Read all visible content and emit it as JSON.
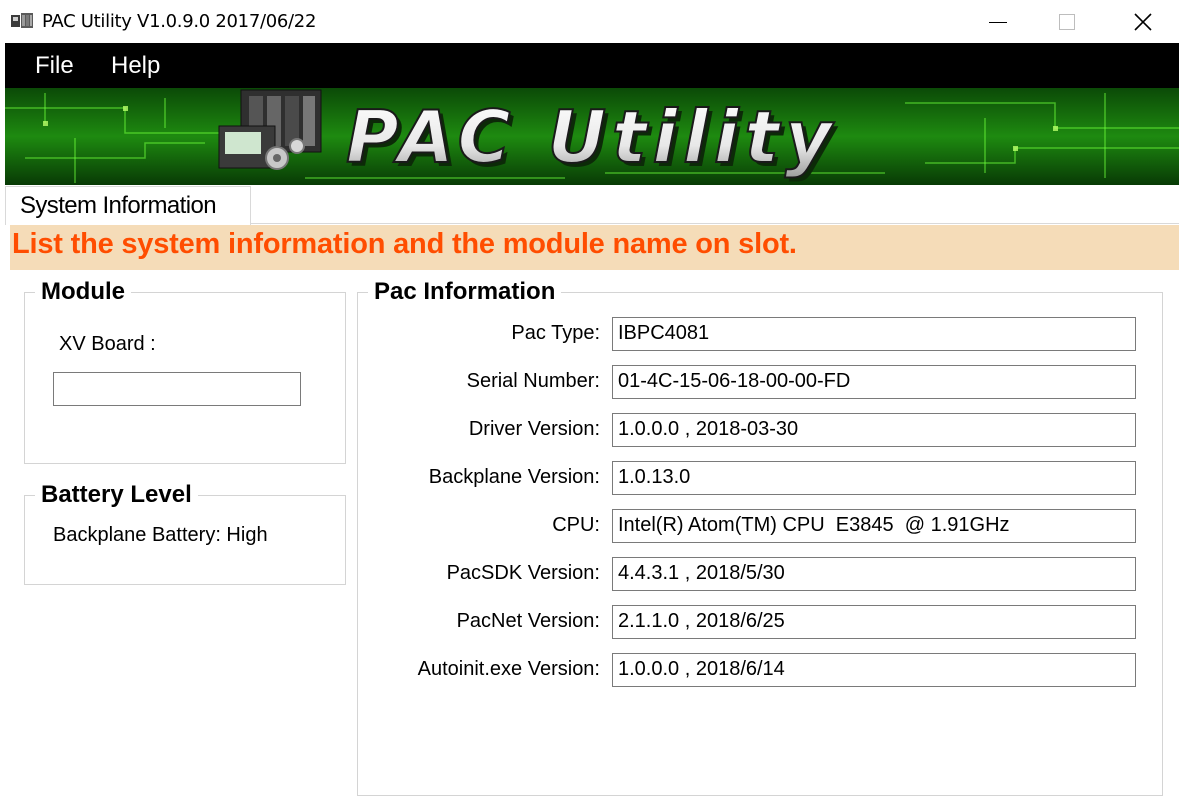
{
  "window": {
    "title": "PAC Utility V1.0.9.0  2017/06/22",
    "controls": {
      "minimize_icon": "minimize-icon",
      "maximize_icon": "maximize-icon",
      "close_icon": "close-icon"
    }
  },
  "menu": {
    "items": [
      "File",
      "Help"
    ]
  },
  "banner": {
    "text": "PAC Utility"
  },
  "tabs": [
    {
      "label": "System Information",
      "active": true
    }
  ],
  "heading": {
    "text": "List the system information and the module name on slot.",
    "color": "#ff4d00",
    "background": "#f5dcb8"
  },
  "module": {
    "title": "Module",
    "xv_board_label": "XV Board :",
    "xv_board_value": ""
  },
  "battery": {
    "title": "Battery Level",
    "status": "Backplane Battery: High"
  },
  "pac_info": {
    "title": "Pac Information",
    "rows": [
      {
        "label": "Pac Type:",
        "value": "IBPC4081"
      },
      {
        "label": "Serial Number:",
        "value": "01-4C-15-06-18-00-00-FD"
      },
      {
        "label": "Driver Version:",
        "value": "1.0.0.0 , 2018-03-30"
      },
      {
        "label": "Backplane Version:",
        "value": "1.0.13.0"
      },
      {
        "label": "CPU:",
        "value": "Intel(R) Atom(TM) CPU  E3845  @ 1.91GHz"
      },
      {
        "label": "PacSDK Version:",
        "value": "4.4.3.1 , 2018/5/30"
      },
      {
        "label": "PacNet Version:",
        "value": "2.1.1.0 , 2018/6/25"
      },
      {
        "label": "Autoinit.exe Version:",
        "value": "1.0.0.0 , 2018/6/14"
      }
    ]
  }
}
